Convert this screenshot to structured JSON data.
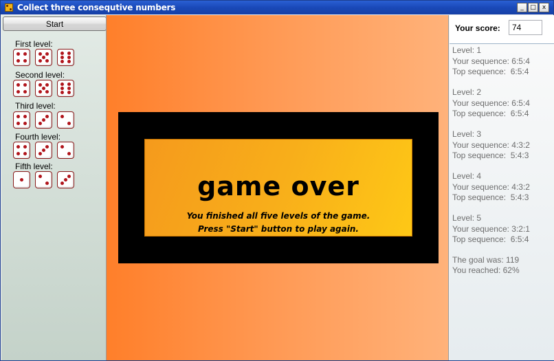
{
  "window": {
    "title": "Collect three consequtive numbers",
    "minimize": "_",
    "maximize": "□",
    "close": "x"
  },
  "left": {
    "start_label": "Start",
    "levels": [
      {
        "label": "First level:",
        "dice": [
          4,
          5,
          6
        ]
      },
      {
        "label": "Second level:",
        "dice": [
          4,
          5,
          6
        ]
      },
      {
        "label": "Third level:",
        "dice": [
          4,
          3,
          2
        ]
      },
      {
        "label": "Fourth level:",
        "dice": [
          4,
          3,
          2
        ]
      },
      {
        "label": "Fifth level:",
        "dice": [
          1,
          2,
          3
        ]
      }
    ]
  },
  "center": {
    "title": "game over",
    "line1": "You finished all five levels of the game.",
    "line2": "Press \"Start\" button to play again."
  },
  "right": {
    "score_label": "Your score:",
    "score_value": "74",
    "levels": [
      {
        "level": "Level: 1",
        "yours": "Your sequence: 6:5:4",
        "top": "Top sequence:  6:5:4"
      },
      {
        "level": "Level: 2",
        "yours": "Your sequence: 6:5:4",
        "top": "Top sequence:  6:5:4"
      },
      {
        "level": "Level: 3",
        "yours": "Your sequence: 4:3:2",
        "top": "Top sequence:  5:4:3"
      },
      {
        "level": "Level: 4",
        "yours": "Your sequence: 4:3:2",
        "top": "Top sequence:  5:4:3"
      },
      {
        "level": "Level: 5",
        "yours": "Your sequence: 3:2:1",
        "top": "Top sequence:  6:5:4"
      }
    ],
    "goal": "The goal was: 119",
    "reached": "You reached: 62%"
  },
  "colors": {
    "titlebar": "#1a49b8",
    "pip": "#b0141b",
    "board_left": "#ff7f2a",
    "board_right": "#ffb27a",
    "banner": "#f8ae1a"
  }
}
